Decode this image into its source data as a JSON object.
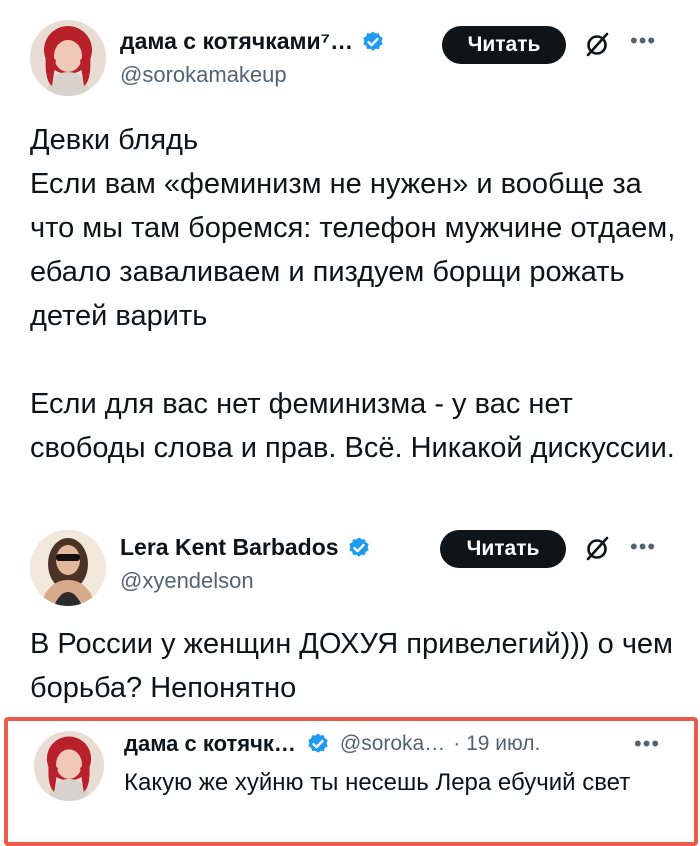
{
  "posts": [
    {
      "name": "дама с котячками⁷…",
      "handle": "@sorokamakeup",
      "follow_label": "Читать",
      "text": "Девки блядь\nЕсли вам «феминизм не нужен» и вообще за что мы там боремся: телефон мужчине отдаем, ебало заваливаем и пиздуем борщи рожать детей варить\n\nЕсли для вас нет феминизма - у вас нет свободы слова и прав. Всё. Никакой дискуссии."
    },
    {
      "name": "Lera Kent Barbados",
      "handle": "@xyendelson",
      "follow_label": "Читать",
      "text": "В России у женщин ДОХУЯ привелегий))) о чем борьба? Непонятно"
    }
  ],
  "reply": {
    "name": "дама с котячк…",
    "handle": "@soroka…",
    "date": "· 19 июл.",
    "text": "Какую же хуйню ты несешь Лера ебучий свет"
  },
  "icons": {
    "verified": "verified-badge-icon",
    "grok": "grok-icon",
    "more": "more-icon"
  },
  "colors": {
    "verified": "#1d9bf0",
    "highlight_border": "#ec5b4a",
    "button": "#0f1419",
    "secondary_text": "#536471"
  }
}
